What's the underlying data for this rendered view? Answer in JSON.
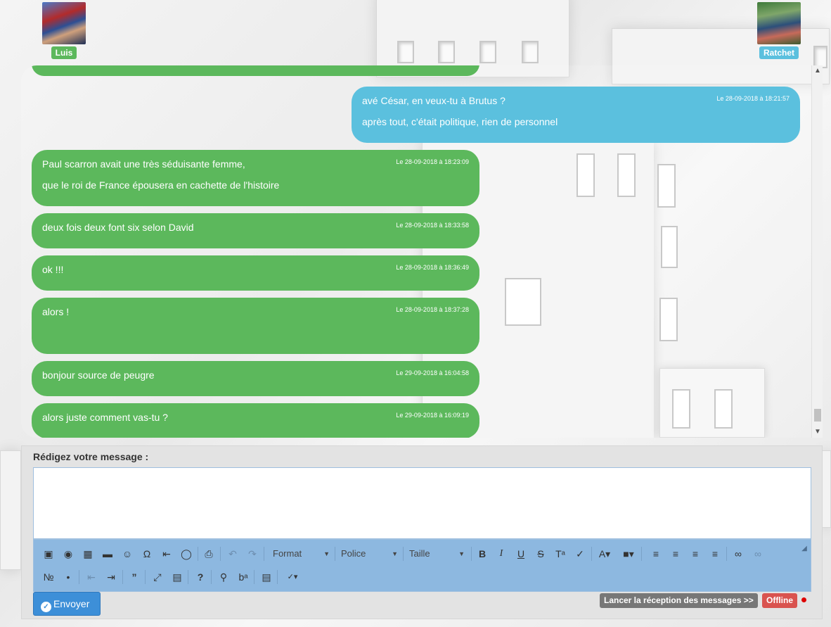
{
  "participants": {
    "left": {
      "name": "Luis"
    },
    "right": {
      "name": "Ratchet"
    }
  },
  "messages": [
    {
      "side": "right",
      "lines": [
        "avé César, en veux-tu à Brutus ?",
        "après tout, c'était politique, rien de personnel"
      ],
      "time": "Le 28-09-2018 à 18:21:57"
    },
    {
      "side": "left",
      "lines": [
        "Paul scarron avait une très séduisante femme,",
        "que le roi de France épousera en cachette de l'histoire"
      ],
      "time": "Le 28-09-2018 à 18:23:09"
    },
    {
      "side": "left",
      "lines": [
        "deux fois deux font six selon David"
      ],
      "time": "Le 28-09-2018 à 18:33:58"
    },
    {
      "side": "left",
      "lines": [
        "ok !!!"
      ],
      "time": "Le 28-09-2018 à 18:36:49"
    },
    {
      "side": "left",
      "lines": [
        "alors !"
      ],
      "time": "Le 28-09-2018 à 18:37:28"
    },
    {
      "side": "left",
      "lines": [
        "bonjour source de peugre"
      ],
      "time": "Le 29-09-2018 à 16:04:58"
    },
    {
      "side": "left",
      "lines": [
        "alors juste comment vas-tu ?"
      ],
      "time": "Le 29-09-2018 à 16:09:19"
    }
  ],
  "composer": {
    "label": "Rédigez votre message :",
    "value": "",
    "toolbar": {
      "format_label": "Format",
      "font_label": "Police",
      "size_label": "Taille"
    },
    "send_label": "Envoyer",
    "launch_label": "Lancer la réception des messages >>",
    "status_label": "Offline"
  },
  "colors": {
    "left_bubble": "#5cb85c",
    "right_bubble": "#5bc0de",
    "send_button": "#3d8fd8",
    "status_offline": "#d9534f"
  }
}
